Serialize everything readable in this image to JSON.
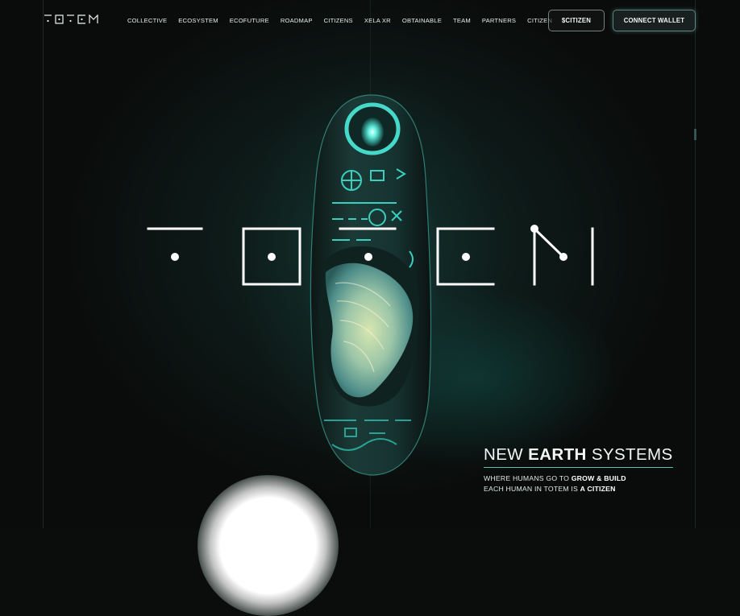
{
  "brand": {
    "logo_text": "TOTEM",
    "wordmark_text": "TOTEM",
    "accent": "#58c2b2",
    "glow": "#3fe0d0"
  },
  "nav": {
    "items": [
      {
        "label": "COLLECTIVE"
      },
      {
        "label": "ECOSYSTEM"
      },
      {
        "label": "ECOFUTURE"
      },
      {
        "label": "ROADMAP"
      },
      {
        "label": "CITIZENS"
      },
      {
        "label": "XELA XR"
      },
      {
        "label": "OBTAINABLE"
      },
      {
        "label": "TEAM"
      },
      {
        "label": "PARTNERS"
      },
      {
        "label": "CITIZEN"
      }
    ]
  },
  "actions": {
    "citizen_token": "$CITIZEN",
    "connect_wallet": "CONNECT WALLET"
  },
  "hero": {
    "headline_pre": "NEW ",
    "headline_bold": "EARTH",
    "headline_post": " SYSTEMS",
    "line1_pre": "WHERE HUMANS GO TO ",
    "line1_bold": "GROW & BUILD",
    "line2_pre": "EACH HUMAN IN TOTEM IS ",
    "line2_bold": "A CITIZEN"
  }
}
